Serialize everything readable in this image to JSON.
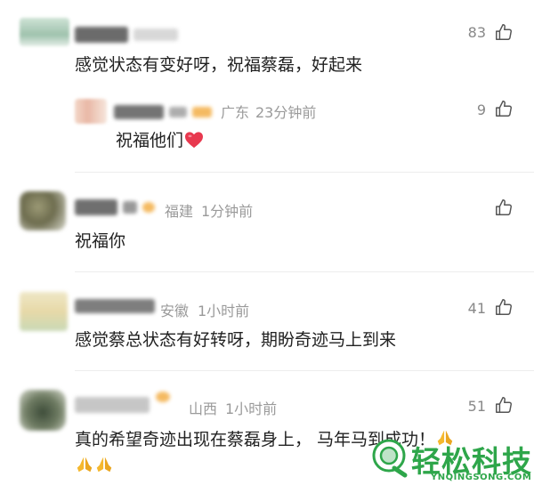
{
  "comments": [
    {
      "text": "感觉状态有变好呀，祝福蔡磊，好起来",
      "likes": "83"
    },
    {
      "location": "广东",
      "time": "23分钟前",
      "text": "祝福他们",
      "likes": "9"
    },
    {
      "location": "福建",
      "time": "1分钟前",
      "text": "祝福你"
    },
    {
      "location": "安徽",
      "time": "1小时前",
      "text": "感觉蔡总状态有好转呀，期盼奇迹马上到来",
      "likes": "41"
    },
    {
      "location": "山西",
      "time": "1小时前",
      "text": "真的希望奇迹出现在蔡磊身上，  马年马到成功！",
      "likes": "51"
    }
  ],
  "watermark": {
    "brand": "轻松科技",
    "domain": "YNQINGSONG.COM"
  },
  "colors": {
    "heart": "#e8394f",
    "pray": "#f5b82e",
    "watermark": "#2ea64a"
  },
  "icons": [
    "thumbs-up-icon",
    "heart-emoji",
    "praying-hands-emoji"
  ]
}
